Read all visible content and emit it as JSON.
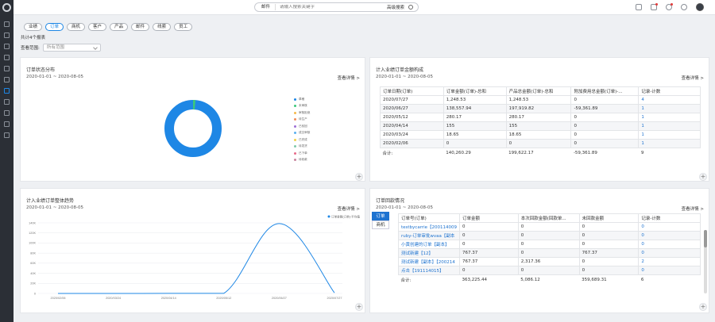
{
  "topbar": {
    "search_scope": "邮件",
    "search_placeholder": "请输入搜索关键字",
    "advanced_search": "高级搜索"
  },
  "tabs": [
    {
      "label": "业绩",
      "active": false
    },
    {
      "label": "订单",
      "active": true
    },
    {
      "label": "商机",
      "active": false
    },
    {
      "label": "客户",
      "active": false
    },
    {
      "label": "产品",
      "active": false
    },
    {
      "label": "邮件",
      "active": false
    },
    {
      "label": "线索",
      "active": false
    },
    {
      "label": "员工",
      "active": false
    }
  ],
  "report_count": "共计4个报表",
  "scope": {
    "label": "查看范围:",
    "value": "所有范围"
  },
  "common": {
    "view_detail": "查看详情 >",
    "date_range": "2020-01-01 ~ 2020-08-05"
  },
  "card_status": {
    "title": "订单状态分布",
    "legend": [
      {
        "label": "草稿",
        "color": "#1e87e5"
      },
      {
        "label": "未审核",
        "color": "#3cc87a"
      },
      {
        "label": "审核拒绝",
        "color": "#f6b94a"
      },
      {
        "label": "待生产",
        "color": "#f08c5a"
      },
      {
        "label": "已驳回",
        "color": "#9e6fd6"
      },
      {
        "label": "成交审核",
        "color": "#5ab0f0"
      },
      {
        "label": "已完成",
        "color": "#f0d04a"
      },
      {
        "label": "待发货",
        "color": "#7fc8a9"
      },
      {
        "label": "已下单",
        "color": "#e86b8a"
      },
      {
        "label": "待收款",
        "color": "#c7849e"
      }
    ]
  },
  "card_amount": {
    "title": "计入业绩订单金额构成",
    "headers": [
      "订单日期(订单)",
      "订单金额(订单)-总和",
      "产品总金额(订单)-总和",
      "附加费用总金额(订单)-...",
      "记录-计数"
    ],
    "rows": [
      [
        "2020/07/27",
        "1,248.53",
        "1,248.53",
        "0",
        "4"
      ],
      [
        "2020/06/27",
        "138,557.94",
        "197,919.82",
        "-59,361.89",
        "1"
      ],
      [
        "2020/05/12",
        "280.17",
        "280.17",
        "0",
        "1"
      ],
      [
        "2020/04/14",
        "155",
        "155",
        "0",
        "1"
      ],
      [
        "2020/03/24",
        "18.65",
        "18.65",
        "0",
        "1"
      ],
      [
        "2020/02/06",
        "0",
        "0",
        "0",
        "1"
      ]
    ],
    "total": [
      "合计:",
      "140,260.29",
      "199,622.17",
      "-59,361.89",
      "9"
    ]
  },
  "card_trend": {
    "title": "计入业绩订单整体趋势",
    "legend": "订单金额(订单)-平均值"
  },
  "card_payment": {
    "title": "订单回款情况",
    "side_tabs": [
      "订单",
      "商机"
    ],
    "headers": [
      "订单号(订单)",
      "订单金额",
      "本次回款金额(回款单...",
      "未回款金额",
      "记录-计数"
    ],
    "rows": [
      [
        "testbycarrie【200114009",
        "0",
        "0",
        "0",
        "0"
      ],
      [
        "ruby-订单审批wvaa【副本",
        "0",
        "0",
        "0",
        "0"
      ],
      [
        "小黄创建的订单【副本】",
        "0",
        "0",
        "0",
        "0"
      ],
      [
        "测试新建【12】",
        "767.37",
        "0",
        "767.37",
        "0"
      ],
      [
        "测试新建【副本】【200214",
        "767.37",
        "2,317.36",
        "0",
        "2"
      ],
      [
        "点击【191114015】",
        "0",
        "0",
        "0",
        "0"
      ]
    ],
    "total": [
      "合计:",
      "363,225.44",
      "5,086.12",
      "359,689.31",
      "6"
    ]
  },
  "chart_data": {
    "type": "line",
    "x": [
      "2020/02/06",
      "2020/03/24",
      "2020/04/14",
      "2020/05/12",
      "2020/06/27",
      "2020/07/27"
    ],
    "series": [
      {
        "name": "订单金额(订单)-平均值",
        "values": [
          0,
          18.65,
          155,
          280.17,
          138557.94,
          1248.53
        ]
      }
    ],
    "yticks": [
      "0",
      "20K",
      "40K",
      "60K",
      "80K",
      "100K",
      "120K",
      "140K"
    ],
    "ylim": [
      0,
      140000
    ],
    "color": "#1e87e5"
  }
}
